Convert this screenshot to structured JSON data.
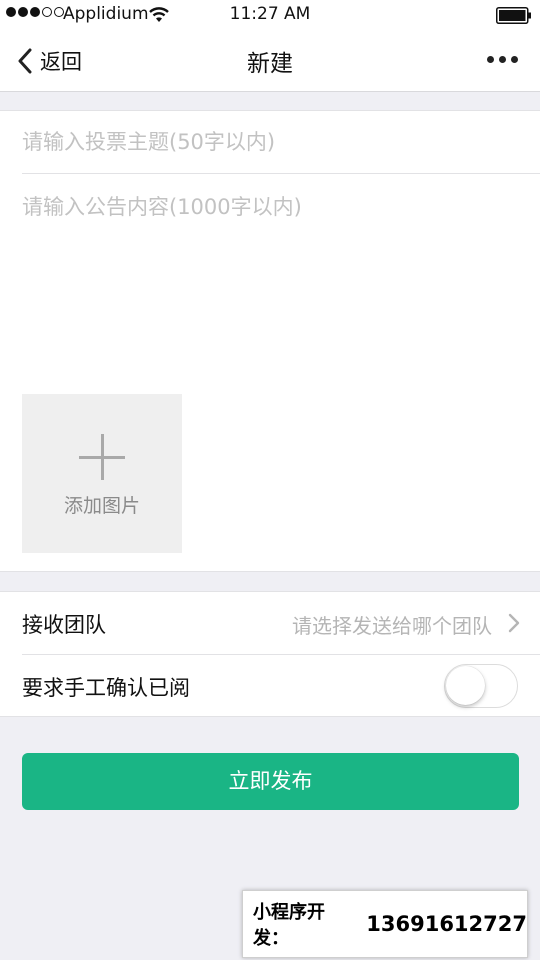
{
  "status_bar": {
    "carrier": "Applidium",
    "time": "11:27 AM"
  },
  "nav": {
    "back_label": "返回",
    "title": "新建"
  },
  "form": {
    "title_placeholder": "请输入投票主题(50字以内)",
    "title_value": "",
    "content_placeholder": "请输入公告内容(1000字以内)",
    "content_value": "",
    "add_image_label": "添加图片"
  },
  "settings": {
    "team_label": "接收团队",
    "team_placeholder": "请选择发送给哪个团队",
    "confirm_label": "要求手工确认已阅",
    "confirm_enabled": false
  },
  "publish_label": "立即发布",
  "contact": {
    "label": "小程序开发：",
    "phone": "13691612727"
  },
  "colors": {
    "accent": "#1ab585",
    "background": "#efeff4",
    "placeholder": "#c2c2c2"
  },
  "icons": [
    "wifi-icon",
    "battery-icon",
    "back-chevron-icon",
    "more-icon",
    "plus-icon",
    "chevron-right-icon"
  ]
}
